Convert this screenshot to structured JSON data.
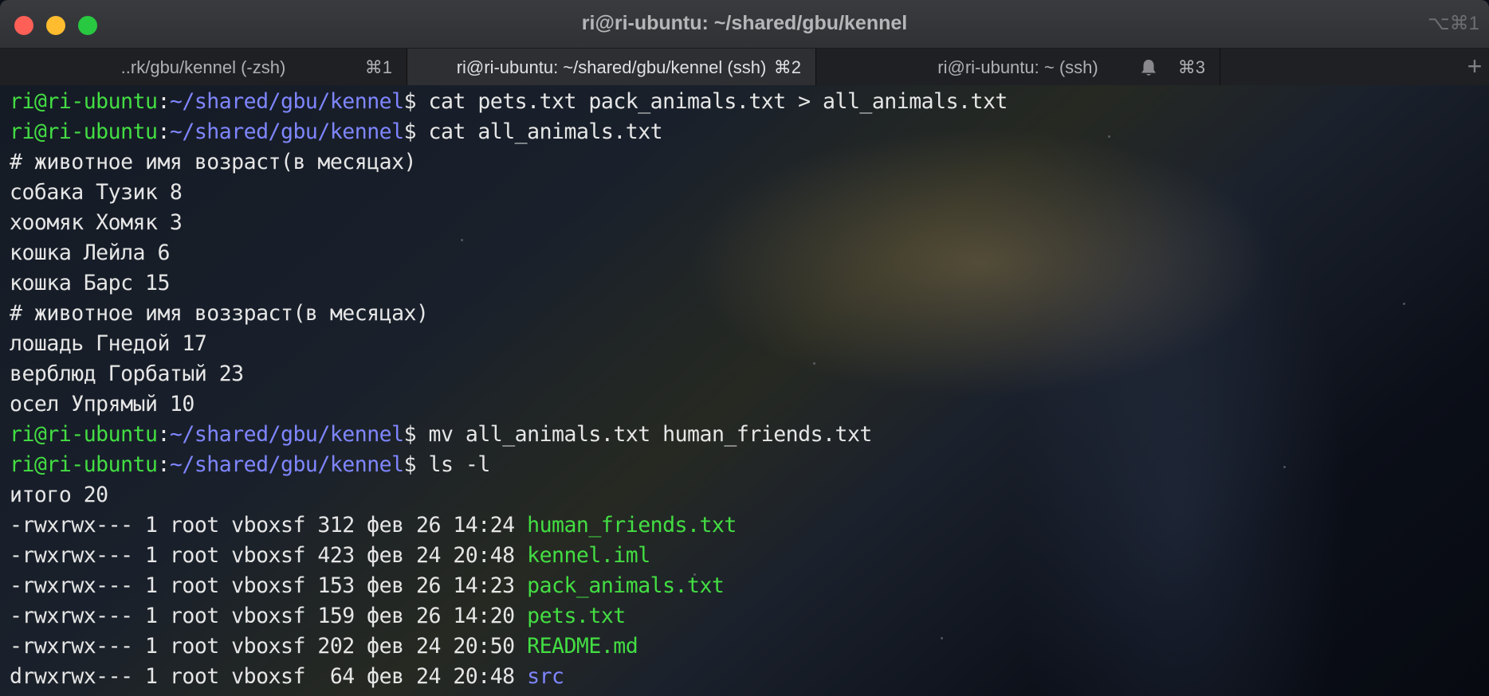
{
  "window": {
    "title": "ri@ri-ubuntu: ~/shared/gbu/kennel",
    "shortcut": "⌥⌘1",
    "colors": {
      "close": "#fe5f57",
      "minimize": "#febc2e",
      "maximize": "#28c840",
      "prompt_user": "#43de43",
      "prompt_path": "#7f86ff",
      "file": "#43de43",
      "directory": "#7f86ff"
    }
  },
  "tabs": [
    {
      "label": "..rk/gbu/kennel (-zsh)",
      "shortcut": "⌘1",
      "active": false
    },
    {
      "label": "ri@ri-ubuntu: ~/shared/gbu/kennel (ssh)",
      "shortcut": "⌘2",
      "active": true
    },
    {
      "label": "ri@ri-ubuntu: ~ (ssh)",
      "shortcut": "⌘3",
      "active": false,
      "icon": "bell-icon"
    }
  ],
  "new_tab": "+",
  "prompt": {
    "user": "ri@ri-ubuntu",
    "sep": ":",
    "path": "~/shared/gbu/kennel",
    "symbol": "$"
  },
  "terminal": {
    "cmd1": "cat pets.txt pack_animals.txt > all_animals.txt",
    "cmd2": "cat all_animals.txt",
    "out": [
      "# животное имя возраст(в месяцах)",
      "собака Тузик 8",
      "хоомяк Хомяк 3",
      "кошка Лейла 6",
      "кошка Барс 15",
      "# животное имя воззраст(в месяцах)",
      "лошадь Гнедой 17",
      "верблюд Горбатый 23",
      "осел Упрямый 10"
    ],
    "cmd3": "mv all_animals.txt human_friends.txt",
    "cmd4": "ls -l",
    "total": "итого 20",
    "listing": [
      {
        "meta": "-rwxrwx--- 1 root vboxsf 312 фев 26 14:24",
        "name": "human_friends.txt",
        "type": "file"
      },
      {
        "meta": "-rwxrwx--- 1 root vboxsf 423 фев 24 20:48",
        "name": "kennel.iml",
        "type": "file"
      },
      {
        "meta": "-rwxrwx--- 1 root vboxsf 153 фев 26 14:23",
        "name": "pack_animals.txt",
        "type": "file"
      },
      {
        "meta": "-rwxrwx--- 1 root vboxsf 159 фев 26 14:20",
        "name": "pets.txt",
        "type": "file"
      },
      {
        "meta": "-rwxrwx--- 1 root vboxsf 202 фев 24 20:50",
        "name": "README.md",
        "type": "file"
      },
      {
        "meta": "drwxrwx--- 1 root vboxsf  64 фев 24 20:48",
        "name": "src",
        "type": "directory"
      }
    ]
  }
}
